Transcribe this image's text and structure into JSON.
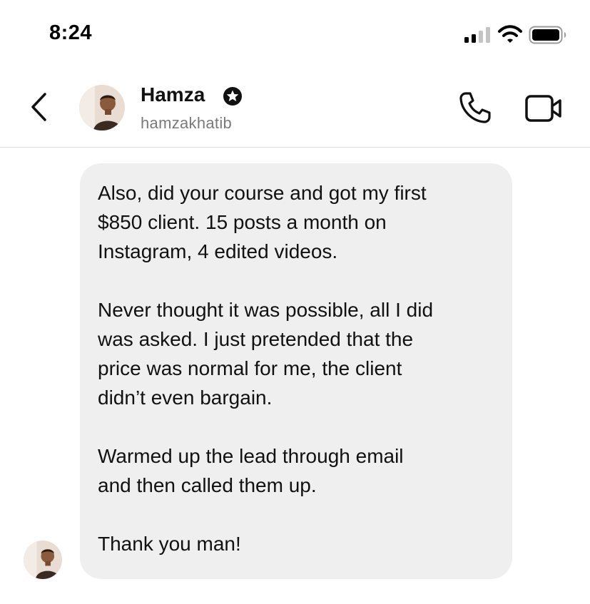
{
  "status_bar": {
    "time": "8:24"
  },
  "header": {
    "contact_name": "Hamza",
    "username": "hamzakhatib",
    "icons": {
      "back": "chevron-left-icon",
      "verified": "verified-badge-icon",
      "call": "phone-icon",
      "video": "video-camera-icon"
    }
  },
  "conversation": {
    "messages": [
      {
        "paragraphs": [
          "Also, did your course and got my first\n$850 client. 15 posts a month on\nInstagram, 4 edited videos.",
          "Never thought it was possible, all I did\nwas asked. I just pretended that the\nprice was normal for me, the client\ndidn’t even bargain.",
          "Warmed up the lead through email\nand then called them up.",
          "Thank you man!"
        ]
      }
    ]
  },
  "colors": {
    "bubble_background": "#efefef",
    "username_text": "#7a7a7a",
    "divider": "#dcdcdc"
  }
}
